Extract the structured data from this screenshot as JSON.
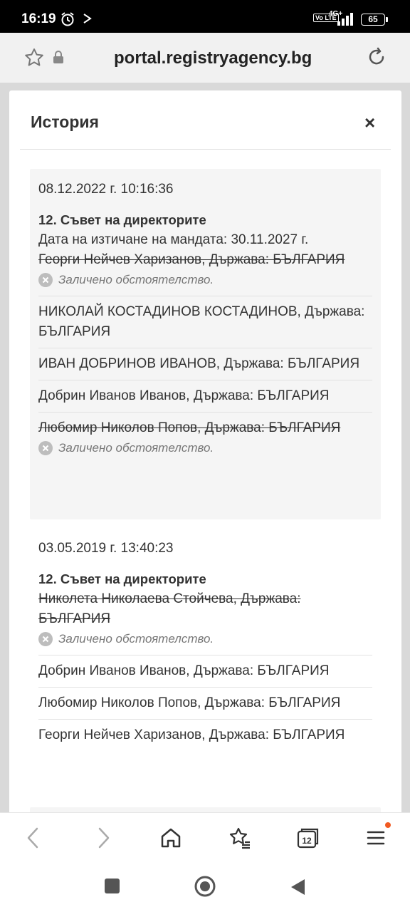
{
  "status": {
    "time": "16:19",
    "volte": "Vo LTE",
    "network": "4G+",
    "battery": "65"
  },
  "browser": {
    "url": "portal.registryagency.bg"
  },
  "modal": {
    "title": "История",
    "close": "×"
  },
  "history": [
    {
      "date": "08.12.2022 г. 10:16:36",
      "section": "12. Съвет на директорите",
      "mandate": "Дата на изтичане на мандата: 30.11.2027 г.",
      "items": [
        {
          "text": "Георги Нейчев Харизанов, Държава: БЪЛГАРИЯ",
          "deleted": true,
          "note": "Заличено обстоятелство."
        },
        {
          "text": "НИКОЛАЙ КОСТАДИНОВ КОСТАДИНОВ, Държава: БЪЛГАРИЯ",
          "deleted": false
        },
        {
          "text": "ИВАН ДОБРИНОВ ИВАНОВ, Държава: БЪЛГАРИЯ",
          "deleted": false
        },
        {
          "text": "Добрин Иванов Иванов, Държава: БЪЛГАРИЯ",
          "deleted": false
        },
        {
          "text": "Любомир Николов Попов, Държава: БЪЛГАРИЯ",
          "deleted": true,
          "note": "Заличено обстоятелство."
        }
      ]
    },
    {
      "date": "03.05.2019 г. 13:40:23",
      "section": "12. Съвет на директорите",
      "items": [
        {
          "text": "Николета Николаева Стойчева, Държава: БЪЛГАРИЯ",
          "deleted": true,
          "note": "Заличено обстоятелство."
        },
        {
          "text": "Добрин Иванов Иванов, Държава: БЪЛГАРИЯ",
          "deleted": false
        },
        {
          "text": "Любомир Николов Попов, Държава: БЪЛГАРИЯ",
          "deleted": false
        },
        {
          "text": "Георги Нейчев Харизанов, Държава: БЪЛГАРИЯ",
          "deleted": false
        }
      ]
    }
  ],
  "nav": {
    "tabs_count": "12"
  },
  "colors": {
    "accent": "#f15a22",
    "entry_bg": "#f5f5f5"
  }
}
